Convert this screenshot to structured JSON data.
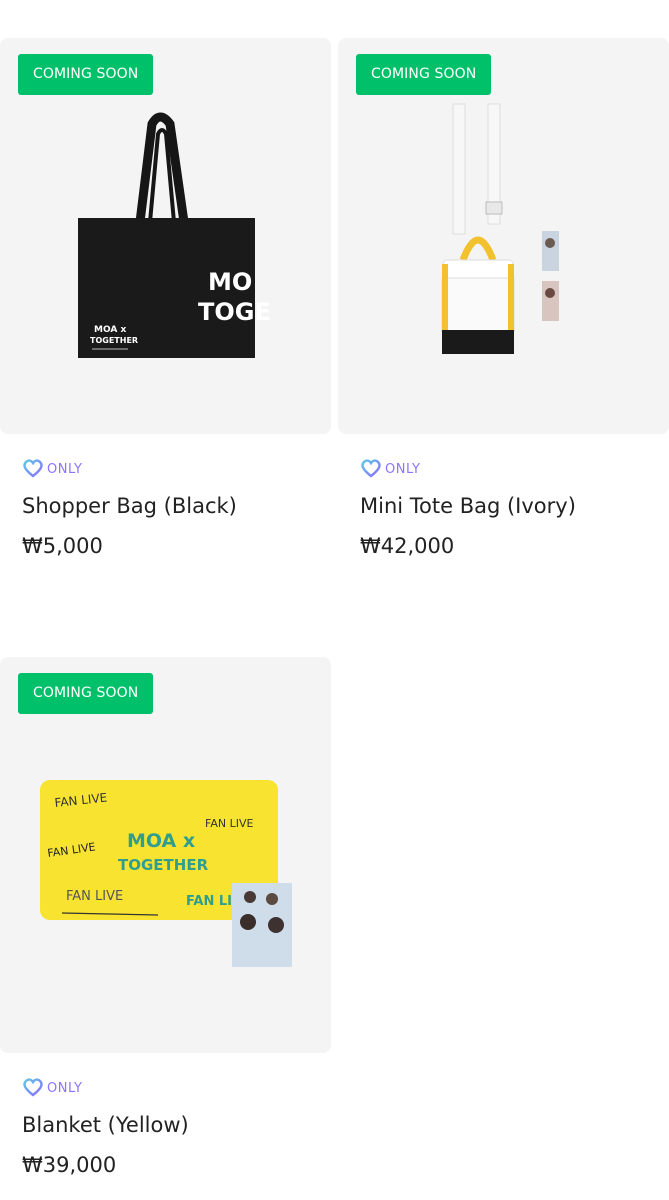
{
  "products": [
    {
      "badge": "COMING SOON",
      "only_label": "ONLY",
      "name": "Shopper Bag (Black)",
      "price": "₩5,000"
    },
    {
      "badge": "COMING SOON",
      "only_label": "ONLY",
      "name": "Mini Tote Bag (Ivory)",
      "price": "₩42,000"
    },
    {
      "badge": "COMING SOON",
      "only_label": "ONLY",
      "name": "Blanket (Yellow)",
      "price": "₩39,000"
    }
  ],
  "product_images": [
    {
      "icon": "shopper-bag-black",
      "print_text": [
        "MO",
        "TOGE",
        "MOA x",
        "TOGETHER"
      ]
    },
    {
      "icon": "mini-tote-bag-ivory"
    },
    {
      "icon": "blanket-yellow",
      "print_text": [
        "FAN LIVE",
        "FAN LIVE",
        "FAN LIVE",
        "MOA x",
        "TOGETHER",
        "FAN LIVE",
        "FAN LI"
      ]
    }
  ],
  "colors": {
    "badge": "#00c16a",
    "only": "#8a75ff",
    "thumb_bg": "#f4f4f4"
  }
}
